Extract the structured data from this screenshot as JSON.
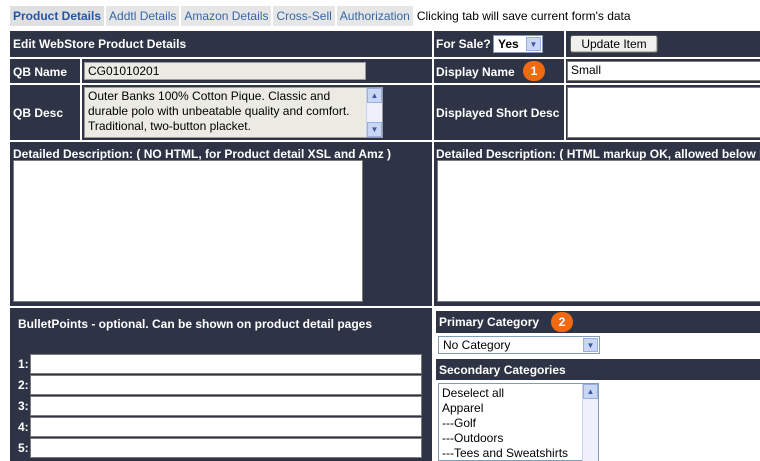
{
  "tabs": [
    {
      "label": "Product Details",
      "active": true
    },
    {
      "label": "Addtl Details",
      "active": false
    },
    {
      "label": "Amazon Details",
      "active": false
    },
    {
      "label": "Cross-Sell",
      "active": false
    },
    {
      "label": "Authorization",
      "active": false
    }
  ],
  "tab_note": "Clicking tab will save current form's data",
  "left": {
    "header": "Edit WebStore Product Details",
    "qb_name_label": "QB Name",
    "qb_name_value": "CG01010201",
    "qb_desc_label": "QB Desc",
    "qb_desc_value": "Outer Banks 100% Cotton Pique.  Classic and durable polo with unbeatable quality and comfort. Traditional, two-button placket.",
    "detailed_desc_label": "Detailed Description: ( NO HTML, for Product detail XSL and Amz )"
  },
  "right": {
    "for_sale_label": "For Sale?",
    "for_sale_value": "Yes",
    "update_button": "Update Item",
    "display_name_label": "Display Name",
    "display_name_value": "Small",
    "display_name_badge": "1",
    "short_desc_label": "Displayed Short Desc",
    "detailed_desc_label": "Detailed Description: ( HTML markup OK, allowed below F"
  },
  "bullets": {
    "header": "BulletPoints - optional. Can be shown on product detail pages",
    "numbers": [
      "1:",
      "2:",
      "3:",
      "4:",
      "5:"
    ]
  },
  "categories": {
    "primary_label": "Primary Category",
    "primary_badge": "2",
    "primary_value": "No Category",
    "secondary_label": "Secondary Categories",
    "secondary_options": [
      "Deselect all",
      "Apparel",
      "---Golf",
      "---Outdoors",
      "---Tees and Sweatshirts"
    ]
  },
  "icons": {
    "scroll_up": "scroll-up-arrow-icon",
    "scroll_down": "scroll-down-arrow-icon",
    "dropdown": "chevron-down-icon"
  },
  "colors": {
    "panel_bg": "#2e3445",
    "badge": "#f26a10",
    "tab_text": "#3366aa"
  }
}
